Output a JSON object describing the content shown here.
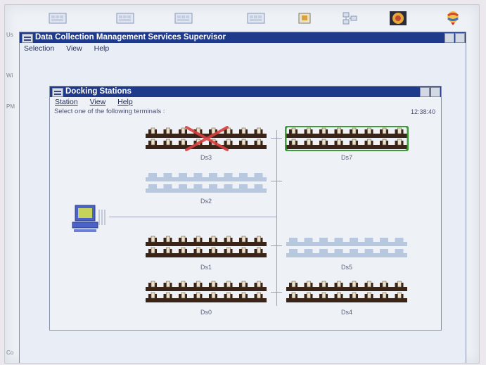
{
  "desktop": {
    "icons": [
      "folder-icon",
      "folder-icon",
      "folder-icon",
      "folder-icon",
      "notepad-icon",
      "network-icon",
      "os2-logo-icon",
      "globe-icon"
    ],
    "left_fragments": [
      "Us",
      "Wi",
      "PM",
      "Co"
    ]
  },
  "main_window": {
    "title": "Data Collection Management Services Supervisor",
    "menu": [
      "Selection",
      "View",
      "Help"
    ]
  },
  "docking_window": {
    "title": "Docking Stations",
    "menu": [
      "Station",
      "View",
      "Help"
    ],
    "prompt": "Select one of the following terminals :",
    "time": "12:38:40",
    "stations": [
      {
        "id": "Ds3",
        "state": "unavailable"
      },
      {
        "id": "Ds7",
        "state": "selected"
      },
      {
        "id": "Ds2",
        "state": "empty"
      },
      {
        "id": "Ds1",
        "state": "occupied"
      },
      {
        "id": "Ds5",
        "state": "empty"
      },
      {
        "id": "Ds0",
        "state": "occupied"
      },
      {
        "id": "Ds4",
        "state": "occupied"
      }
    ]
  },
  "colors": {
    "titlebar": "#1f3a8a",
    "station_dark": "#3a2418",
    "station_empty": "#b8c8de",
    "terminal": "#e8e1cc",
    "selection_border": "#3f9b3a",
    "cross": "#d84040"
  }
}
